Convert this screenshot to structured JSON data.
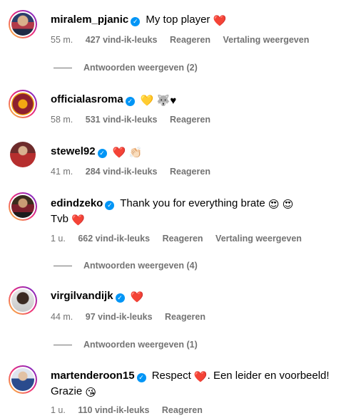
{
  "comments": [
    {
      "username": "miralem_pjanic",
      "text": "My top player",
      "emoji": "❤️",
      "time": "55 m.",
      "likes": "427 vind-ik-leuks",
      "reply": "Reageren",
      "translate": "Vertaling weergeven",
      "replies_label": "Antwoorden weergeven (2)"
    },
    {
      "username": "officialasroma",
      "text": "",
      "emoji": "💛 🐺♥",
      "time": "58 m.",
      "likes": "531 vind-ik-leuks",
      "reply": "Reageren"
    },
    {
      "username": "stewel92",
      "text": "",
      "emoji": "❤️ 👏🏻",
      "time": "41 m.",
      "likes": "284 vind-ik-leuks",
      "reply": "Reageren"
    },
    {
      "username": "edindzeko",
      "text": "Thank you for everything brate",
      "emoji": "😍 😍",
      "line2": "Tvb",
      "line2_emoji": "❤️",
      "time": "1 u.",
      "likes": "662 vind-ik-leuks",
      "reply": "Reageren",
      "translate": "Vertaling weergeven",
      "replies_label": "Antwoorden weergeven (4)"
    },
    {
      "username": "virgilvandijk",
      "text": "",
      "emoji": "❤️",
      "time": "44 m.",
      "likes": "97 vind-ik-leuks",
      "reply": "Reageren",
      "replies_label": "Antwoorden weergeven (1)"
    },
    {
      "username": "martenderoon15",
      "text": "Respect",
      "emoji": "❤️",
      "text_after": ". Een leider en voorbeeld!",
      "line2": "Grazie",
      "line2_emoji": "😘",
      "time": "1 u.",
      "likes": "110 vind-ik-leuks",
      "reply": "Reageren"
    }
  ],
  "colors": {
    "verified": "#0095f6",
    "meta_text": "#737373",
    "heart": "#ed0b38"
  },
  "icons": {
    "verified": "verified-badge-icon"
  }
}
